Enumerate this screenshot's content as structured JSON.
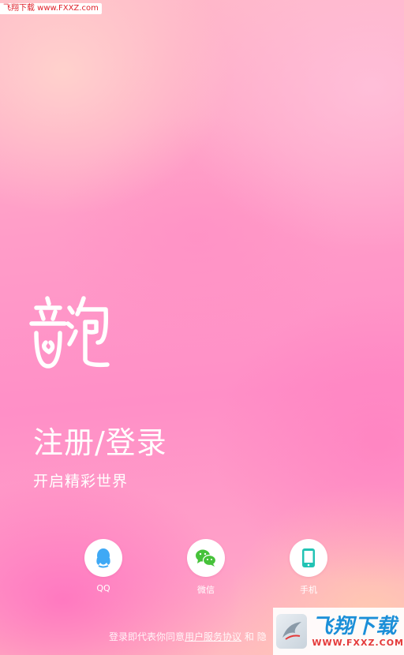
{
  "watermark_top": {
    "text": "飞翔下载 www.FXXZ.com"
  },
  "app": {
    "logo_text": "音泡"
  },
  "login": {
    "title": "注册/登录",
    "subtitle": "开启精彩世界"
  },
  "social": [
    {
      "label": "QQ",
      "icon": "qq-icon",
      "color": "#3fa9f5"
    },
    {
      "label": "微信",
      "icon": "wechat-icon",
      "color": "#46c23a"
    },
    {
      "label": "手机",
      "icon": "phone-icon",
      "color": "#22c3b4"
    }
  ],
  "agreement": {
    "prefix": "登录即代表你同意",
    "link": "用户服务协议",
    "middle": "和",
    "suffix": "隐"
  },
  "watermark_bottom": {
    "main": "飞翔下载",
    "sub": "WWW.FXXZ.COM"
  }
}
